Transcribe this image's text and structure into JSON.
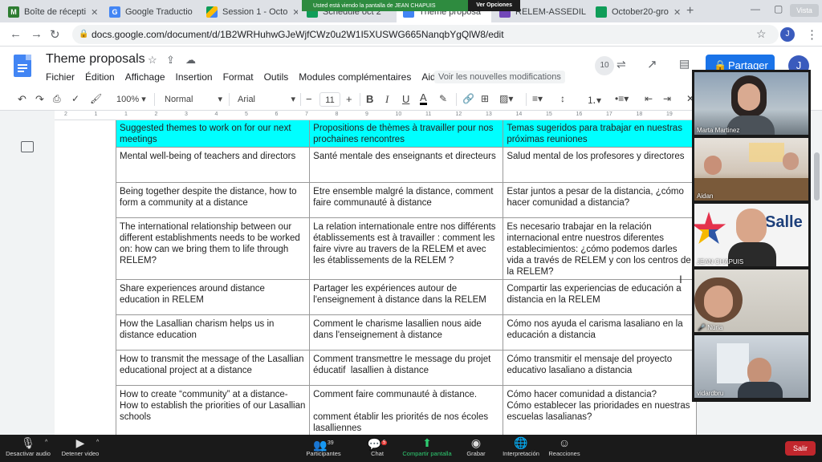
{
  "browser": {
    "tabs": [
      {
        "title": "Boîte de récepti",
        "icon": "gmail-icon"
      },
      {
        "title": "Google Traductio",
        "icon": "translate-icon"
      },
      {
        "title": "Session 1 - Octo",
        "icon": "drive-icon"
      },
      {
        "title": "Schedule oct 2",
        "icon": "sheets-icon"
      },
      {
        "title": "Theme proposa",
        "icon": "docs-icon"
      },
      {
        "title": "RELEM-ASSEDIL",
        "icon": "forms-icon"
      },
      {
        "title": "October20-gro",
        "icon": "sheets-icon"
      }
    ],
    "vista_label": "Vista",
    "url": "docs.google.com/document/d/1B2WRHuhwGJeWjfCWz0u2W1I5XUSWG665NanqbYgQlW8/edit",
    "profile_initial": "J"
  },
  "share_banner": {
    "text": "Usted está viendo la pantalla de JEAN CHAPUIS",
    "options": "Ver Opciones"
  },
  "docs": {
    "title": "Theme proposals",
    "menus": [
      "Fichier",
      "Édition",
      "Affichage",
      "Insertion",
      "Format",
      "Outils",
      "Modules complémentaires",
      "Aide"
    ],
    "see_changes": "Voir les nouvelles modifications",
    "share_label": "Partager",
    "viewers_count": "10",
    "user_initial": "J"
  },
  "toolbar": {
    "zoom": "100%",
    "style": "Normal",
    "font": "Arial",
    "font_size": "11"
  },
  "ruler": [
    "2",
    "1",
    "1",
    "2",
    "3",
    "4",
    "5",
    "6",
    "7",
    "8",
    "9",
    "10",
    "11",
    "12",
    "13",
    "14",
    "15",
    "16",
    "17",
    "18",
    "19",
    "20"
  ],
  "table": {
    "header": [
      "Suggested themes to work on for our next meetings",
      "Propositions de thèmes à travailler pour nos prochaines rencontres",
      "Temas sugeridos para trabajar en nuestras próximas reuniones"
    ],
    "rows": [
      [
        "Mental well-being of teachers and directors",
        "Santé mentale des enseignants et directeurs",
        "Salud mental de los profesores y directores"
      ],
      [
        "Being together despite the distance, how to form a community at a distance",
        "Etre ensemble malgré la distance, comment faire communauté à distance",
        "Estar juntos a pesar de la distancia, ¿cómo hacer comunidad a distancia?"
      ],
      [
        "The international relationship between our different establishments needs to be worked on: how can we bring them to life through RELEM?",
        "La relation internationale entre nos différents établissements est à travailler : comment les faire vivre au travers de la RELEM et avec les établissements de la RELEM ?",
        "Es necesario trabajar en la relación internacional entre nuestros diferentes establecimientos: ¿cómo podemos darles vida a través de RELEM y con los centros de la RELEM?"
      ],
      [
        "Share experiences around distance education in RELEM",
        "Partager les expériences autour de l'enseignement à distance dans la RELEM",
        "Compartir las experiencias de educación a distancia en la RELEM"
      ],
      [
        "How the Lasallian charism helps us in distance education",
        "Comment le charisme lasallien nous aide dans l'enseignement à distance",
        "Cómo nos ayuda el carisma lasaliano en la educación a distancia"
      ],
      [
        "How to transmit the message of the Lasallian educational project at a distance",
        "Comment transmettre le message du projet éducatif  lasallien à distance",
        "Cómo transmitir el mensaje del proyecto educativo lasaliano a distancia"
      ],
      [
        "How to create “community” at a distance- How to establish the priorities of our Lasallian schools",
        "Comment faire communauté à distance.\n\ncomment établir les priorités de nos écoles lasalliennes",
        "Cómo hacer comunidad a distancia?\nCómo establecer las prioridades en nuestras escuelas lasalianas?"
      ]
    ]
  },
  "participants": [
    {
      "name": "Marta Martinez"
    },
    {
      "name": "Aidan"
    },
    {
      "name": "JEAN CHAPUIS",
      "logo_text": "Salle"
    },
    {
      "name": "Núria",
      "muted": true
    },
    {
      "name": "vidardbru"
    }
  ],
  "zoom": {
    "mute": "Desactivar audio",
    "video": "Detener video",
    "participants": "Participantes",
    "participants_count": "39",
    "chat": "Chat",
    "chat_badge": "5",
    "share": "Compartir pantalla",
    "record": "Grabar",
    "interpretation": "Interpretación",
    "reactions": "Reacciones",
    "leave": "Salir"
  },
  "colors": {
    "header_row": "#00ffff",
    "share_button": "#1a73e8",
    "zoom_share_green": "#2e8b3f",
    "leave_red": "#c1272d"
  }
}
